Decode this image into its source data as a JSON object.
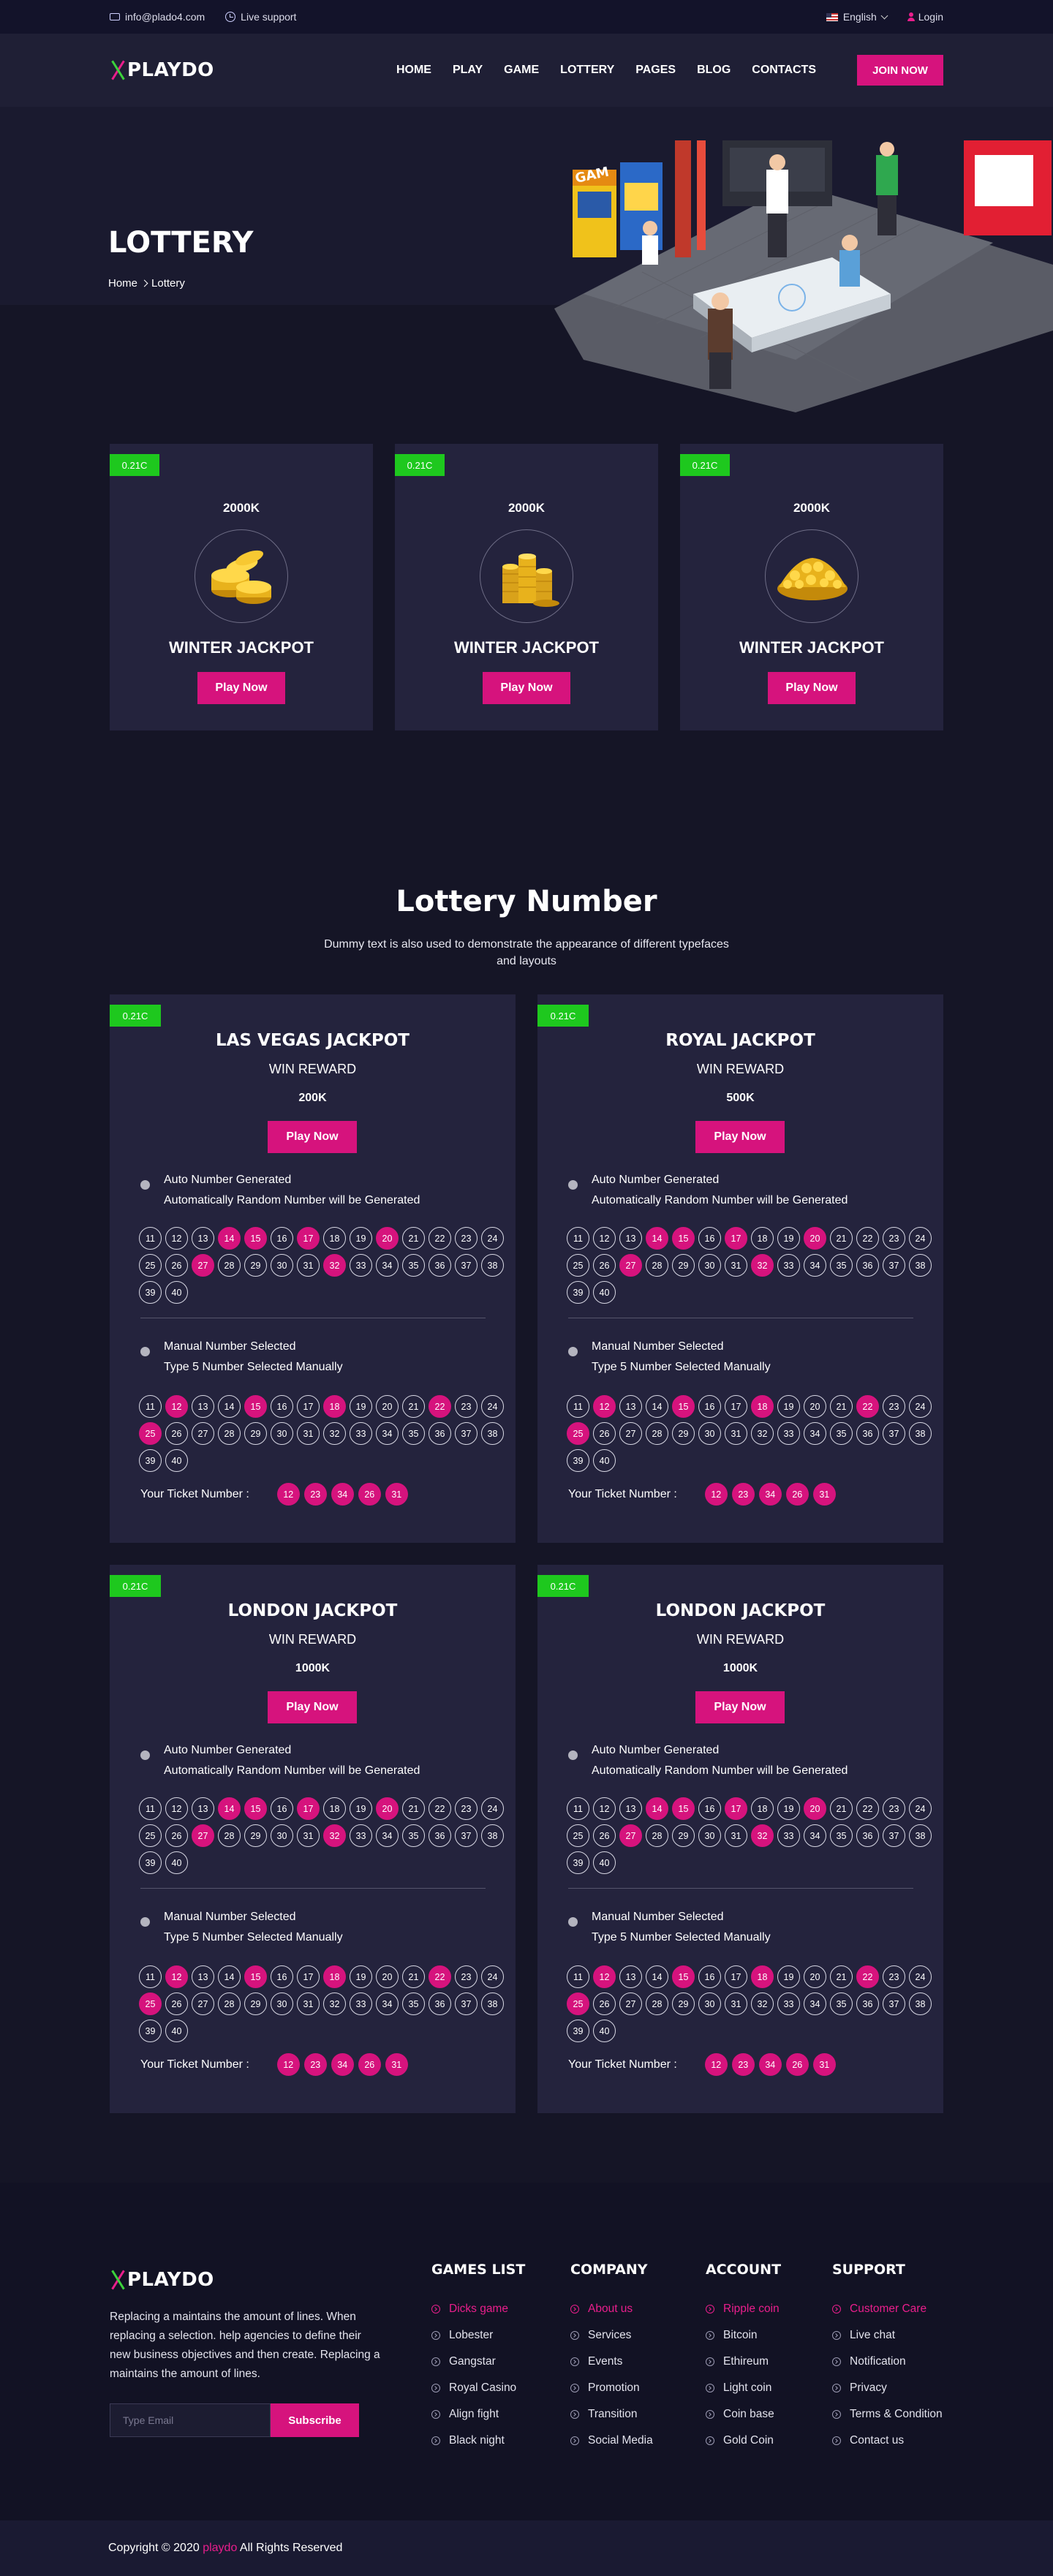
{
  "topbar": {
    "email": "info@plado4.com",
    "support": "Live support",
    "language": "English",
    "login": "Login"
  },
  "brand": {
    "name": "PLAYDO",
    "accent": "#d6137d",
    "green": "#1ec81e"
  },
  "nav": {
    "items": [
      "HOME",
      "PLAY",
      "GAME",
      "LOTTERY",
      "PAGES",
      "BLOG",
      "CONTACTS"
    ],
    "join_label": "JOIN NOW"
  },
  "hero": {
    "title": "LOTTERY",
    "breadcrumb": [
      "Home",
      "Lottery"
    ]
  },
  "jackpots": [
    {
      "tag": "0.21C",
      "amount": "2000K",
      "title": "WINTER JACKPOT",
      "button": "Play Now"
    },
    {
      "tag": "0.21C",
      "amount": "2000K",
      "title": "WINTER JACKPOT",
      "button": "Play Now"
    },
    {
      "tag": "0.21C",
      "amount": "2000K",
      "title": "WINTER JACKPOT",
      "button": "Play Now"
    }
  ],
  "lottery": {
    "title": "Lottery Number",
    "subtitle": "Dummy text is also used to demonstrate the appearance of different typefaces and layouts",
    "cards": [
      {
        "tag": "0.21C",
        "title": "LAS VEGAS JACKPOT",
        "reward": "WIN REWARD",
        "amount": "200K",
        "button": "Play Now"
      },
      {
        "tag": "0.21C",
        "title": "ROYAL JACKPOT",
        "reward": "WIN REWARD",
        "amount": "500K",
        "button": "Play Now"
      },
      {
        "tag": "0.21C",
        "title": "LONDON JACKPOT",
        "reward": "WIN REWARD",
        "amount": "1000K",
        "button": "Play Now"
      },
      {
        "tag": "0.21C",
        "title": "LONDON JACKPOT",
        "reward": "WIN REWARD",
        "amount": "1000K",
        "button": "Play Now"
      }
    ],
    "auto_label": "Auto Number Generated",
    "auto_desc": "Automatically Random Number will be Generated",
    "manual_label": "Manual Number Selected",
    "manual_desc": "Type 5 Number Selected Manually",
    "numbers": [
      11,
      12,
      13,
      14,
      15,
      16,
      17,
      18,
      19,
      20,
      21,
      22,
      23,
      24,
      25,
      26,
      27,
      28,
      29,
      30,
      31,
      32,
      33,
      34,
      35,
      36,
      37,
      38,
      39,
      40
    ],
    "auto_selected": [
      14,
      15,
      17,
      20,
      27,
      32
    ],
    "manual_selected": [
      12,
      15,
      18,
      22,
      25
    ],
    "ticket_label": "Your Ticket Number :",
    "ticket_numbers": [
      12,
      23,
      34,
      26,
      31
    ]
  },
  "footer": {
    "brand": "PLAYDO",
    "description": "Replacing a maintains the amount of lines. When replacing a selection. help agencies to define their new business objectives and then create. Replacing a maintains the amount of lines.",
    "email_placeholder": "Type Email",
    "subscribe": "Subscribe",
    "columns": [
      {
        "title": "GAMES LIST",
        "items": [
          "Dicks game",
          "Lobester",
          "Gangstar",
          "Royal Casino",
          "Align fight",
          "Black night"
        ]
      },
      {
        "title": "COMPANY",
        "items": [
          "About us",
          "Services",
          "Events",
          "Promotion",
          "Transition",
          "Social Media"
        ]
      },
      {
        "title": "ACCOUNT",
        "items": [
          "Ripple coin",
          "Bitcoin",
          "Ethireum",
          "Light coin",
          "Coin base",
          "Gold Coin"
        ]
      },
      {
        "title": "SUPPORT",
        "items": [
          "Customer Care",
          "Live chat",
          "Notification",
          "Privacy",
          "Terms & Condition",
          "Contact us"
        ]
      }
    ],
    "copyright_prefix": "Copyright © 2020",
    "copyright_brand": "playdo",
    "copyright_suffix": "All Rights Reserved"
  }
}
